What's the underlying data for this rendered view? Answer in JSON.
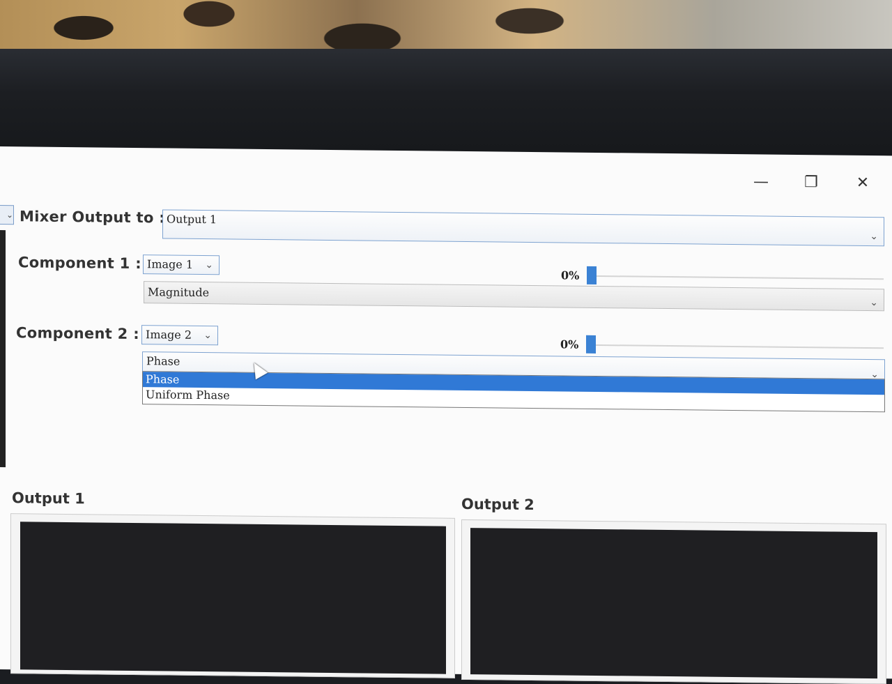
{
  "window": {
    "minimize_icon": "minimize-icon",
    "restore_icon": "restore-icon",
    "close_icon": "close-icon"
  },
  "mixer": {
    "label": "Mixer Output to :",
    "selected": "Output 1"
  },
  "component1": {
    "label": "Component 1 :",
    "image_selected": "Image 1",
    "mode_selected": "Magnitude",
    "percent_text": "0%",
    "slider_value": 0
  },
  "component2": {
    "label": "Component 2 :",
    "image_selected": "Image 2",
    "mode_selected": "Phase",
    "percent_text": "0%",
    "slider_value": 0,
    "dropdown_options": [
      "Phase",
      "Uniform Phase"
    ],
    "dropdown_highlighted": "Phase"
  },
  "outputs": {
    "output1_title": "Output 1",
    "output2_title": "Output 2"
  },
  "colors": {
    "accent": "#3079d6",
    "slider_thumb": "#3b82d4"
  }
}
